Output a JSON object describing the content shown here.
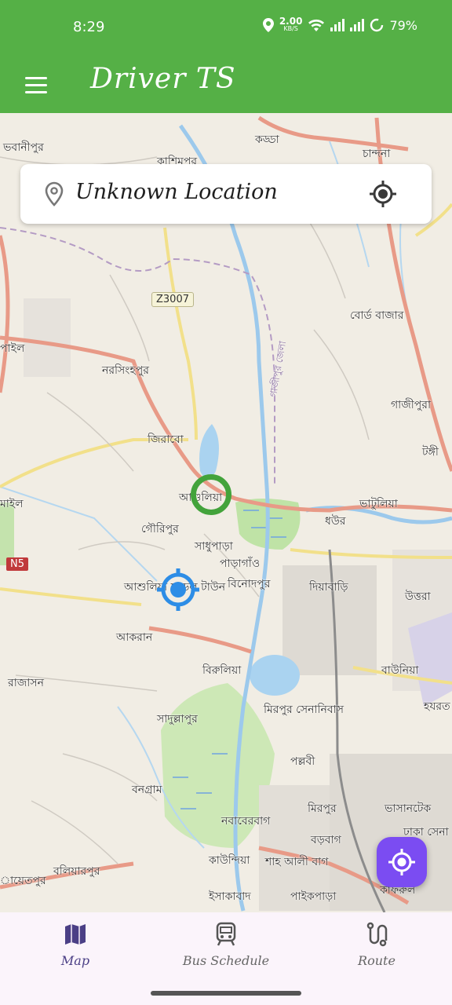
{
  "status_bar": {
    "time": "8:29",
    "net_speed": "2.00",
    "net_unit": "KB/S",
    "battery": "79%"
  },
  "app_bar": {
    "title": "Driver TS",
    "menu_icon": "menu-icon"
  },
  "search": {
    "location_text": "Unknown Location",
    "pin_icon": "location-pin-icon",
    "target_icon": "my-location-icon"
  },
  "map": {
    "labels": [
      "ভবানীপুর",
      "কাশিমপুর",
      "কড্ডা",
      "চান্দনা",
      "বোর্ড বাজার",
      "পাইল",
      "নরসিংহপুর",
      "গাজীপুরা",
      "জিরাবো",
      "টঙ্গী",
      "মাইল",
      "আশুলিয়া",
      "ভাটুলিয়া",
      "গৌরিপুর",
      "ধউর",
      "সাধুপাড়া",
      "পাড়াগাঁও",
      "বিনোদপুর",
      "দিয়াবাড়ি",
      "উত্তরা",
      "আশুলিয়া মডেল টাউন",
      "আকরান",
      "বিরুলিয়া",
      "বাউনিয়া",
      "রাজাসন",
      "মিরপুর সেনানিবাস",
      "হযরত",
      "সাদুল্লাপুর",
      "পল্লবী",
      "বনগ্রাম",
      "মিরপুর",
      "ভাসানটেক",
      "নবাবেরবাগ",
      "বড়বাগ",
      "ঢাকা সেনা",
      "বলিয়ারপুর",
      "কাউন্দিয়া",
      "শাহ আলী বাগ",
      "কাফরুল",
      "ায়েতপুর",
      "ইসাকাবাদ",
      "পাইকপাড়া",
      "গাজীপুর জেলা"
    ],
    "shield_z": "Z3007",
    "shield_n": "N5"
  },
  "fab": {
    "icon": "gps-fixed-icon"
  },
  "bottom_nav": {
    "items": [
      {
        "label": "Map",
        "icon": "map-icon"
      },
      {
        "label": "Bus Schedule",
        "icon": "train-icon"
      },
      {
        "label": "Route",
        "icon": "route-icon"
      }
    ]
  },
  "colors": {
    "primary": "#55b046",
    "fab": "#7b4cf2",
    "nav_bg": "#fbf4fb",
    "active_nav": "#4b3f86"
  }
}
